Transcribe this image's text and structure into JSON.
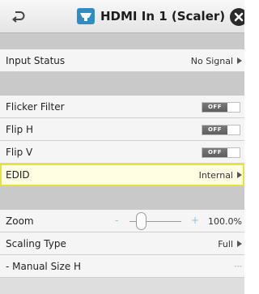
{
  "header": {
    "title": "HDMI In 1 (Scaler)",
    "back_icon": "return-arrow-icon",
    "source_icon": "hdmi-icon",
    "close_icon": "close-icon"
  },
  "rows": {
    "input_status": {
      "label": "Input Status",
      "value": "No Signal"
    },
    "flicker_filter": {
      "label": "Flicker Filter",
      "toggle": "OFF"
    },
    "flip_h": {
      "label": "Flip H",
      "toggle": "OFF"
    },
    "flip_v": {
      "label": "Flip V",
      "toggle": "OFF"
    },
    "edid": {
      "label": "EDID",
      "value": "Internal"
    },
    "zoom": {
      "label": "Zoom",
      "minus": "-",
      "plus": "+",
      "value": "100.0%"
    },
    "scaling_type": {
      "label": "Scaling Type",
      "value": "Full"
    },
    "manual_size_h": {
      "label": "- Manual Size H",
      "value": "---"
    }
  },
  "colors": {
    "accent": "#2f8dc3",
    "selection_border": "#e6e33c",
    "selection_fill": "#fffde2"
  }
}
